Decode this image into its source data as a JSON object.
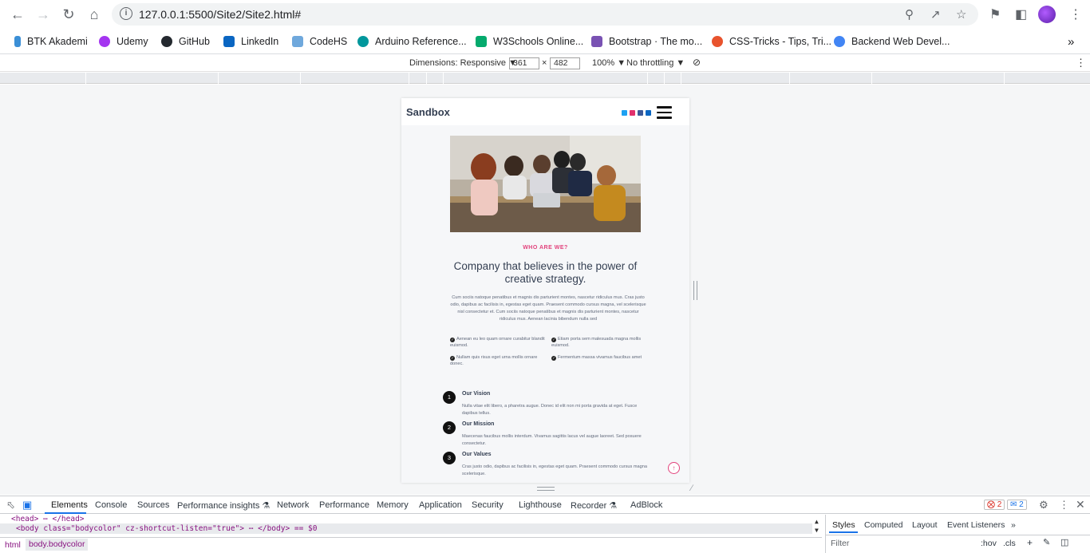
{
  "browser": {
    "url": "127.0.0.1:5500/Site2/Site2.html#",
    "bookmarks": [
      {
        "label": "BTK Akademi",
        "color": "#3b8fd6"
      },
      {
        "label": "Udemy",
        "color": "#a435f0"
      },
      {
        "label": "GitHub",
        "color": "#24292f"
      },
      {
        "label": "LinkedIn",
        "color": "#0a66c2"
      },
      {
        "label": "CodeHS",
        "color": "#6fa8dc"
      },
      {
        "label": "Arduino Reference...",
        "color": "#00979c"
      },
      {
        "label": "W3Schools Online...",
        "color": "#04aa6d"
      },
      {
        "label": "Bootstrap · The mo...",
        "color": "#7952b3"
      },
      {
        "label": "CSS-Tricks - Tips, Tri...",
        "color": "#e8532d"
      },
      {
        "label": "Backend Web Devel...",
        "color": "#4285f4"
      }
    ],
    "more_bookmarks": "»"
  },
  "device_toolbar": {
    "dimensions": "Dimensions: Responsive ▼",
    "width": "361",
    "times": "×",
    "height": "482",
    "zoom": "100% ▼",
    "throttling": "No throttling ▼"
  },
  "site": {
    "brand": "Sandbox",
    "eyebrow": "WHO ARE WE?",
    "headline": "Company that believes in the power of creative strategy.",
    "lead": "Cum sociis natoque penatibus et magnis dis parturient montes, nascetur ridiculus mus. Cras justo odio, dapibus ac facilisis in, egestas eget quam. Praesent commodo cursus magna, vel scelerisque nisl consectetur et. Cum sociis natoque penatibus et magnis dis parturient montes, nascetur ridiculus mus. Aenean lacinia bibendum nulla sed",
    "bullets": [
      "Aenean eu leo quam ornare curabitur blandit euismod.",
      "Etiam porta sem malesuada magna mollis euismod.",
      "Nullam quis risus eget urna mollis ornare donec.",
      "Fermentum massa vivamus faucibus amet"
    ],
    "steps": [
      {
        "num": "1",
        "title": "Our Vision",
        "text": "Nulla vitae elit libero, a pharetra augue. Donec id elit non mi porta gravida at eget. Fusce dapibus tellus."
      },
      {
        "num": "2",
        "title": "Our Mission",
        "text": "Maecenas faucibus mollis interdum. Vivamus sagittis lacus vel augue laoreet. Sed posuere consectetur."
      },
      {
        "num": "3",
        "title": "Our Values",
        "text": "Cras justo odio, dapibus ac facilisis in, egestas eget quam. Praesent commodo cursus magna scelerisque."
      }
    ],
    "accent_color": "#e2427c"
  },
  "devtools": {
    "tabs": [
      "Elements",
      "Console",
      "Sources",
      "Performance insights ⚗",
      "Network",
      "Performance",
      "Memory",
      "Application",
      "Security",
      "Lighthouse",
      "Recorder ⚗",
      "AdBlock"
    ],
    "errors": "2",
    "messages": "2",
    "dom_head": "<head> ⋯ </head>",
    "dom_body": "<body class=\"bodycolor\" cz-shortcut-listen=\"true\"> ⋯ </body> == $0",
    "crumb_html": "html",
    "crumb_body": "body.bodycolor",
    "styles_tabs": [
      "Styles",
      "Computed",
      "Layout",
      "Event Listeners",
      "»"
    ],
    "filter_placeholder": "Filter",
    "hov": ":hov",
    "cls": ".cls"
  }
}
